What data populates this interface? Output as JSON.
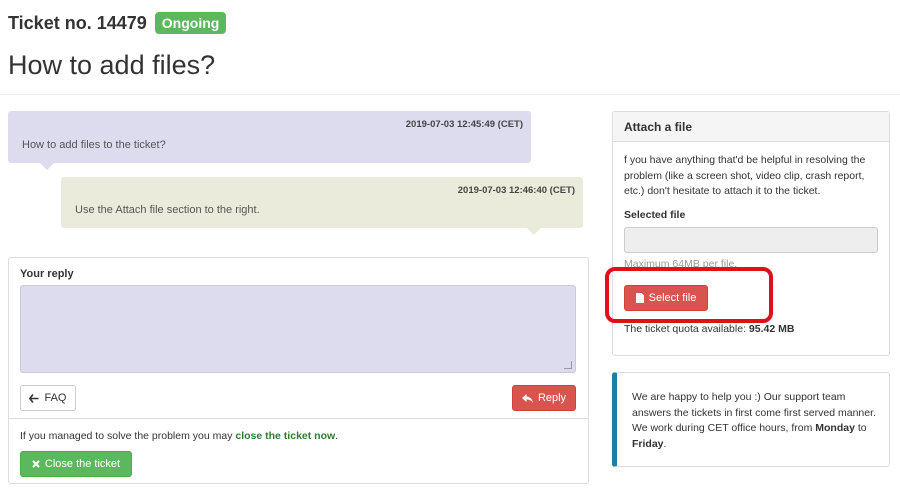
{
  "ticket": {
    "label": "Ticket no.",
    "number": "14479",
    "status": "Ongoing",
    "title": "How to add files?"
  },
  "messages": [
    {
      "time": "2019-07-03 12:45:49 (CET)",
      "text": "How to add files to the ticket?"
    },
    {
      "time": "2019-07-03 12:46:40 (CET)",
      "text": "Use the Attach file section to the right."
    }
  ],
  "reply": {
    "label": "Your reply",
    "faq_label": "FAQ",
    "reply_label": "Reply",
    "close_note_prefix": "If you managed to solve the problem you may ",
    "close_note_link": "close the ticket now",
    "close_note_suffix": ".",
    "close_label": "Close the ticket"
  },
  "attach": {
    "heading": "Attach a file",
    "description": "f you have anything that'd be helpful in resolving the problem (like a screen shot, video clip, crash report, etc.) don't hesitate to attach it to the ticket.",
    "selected_label": "Selected file",
    "max_note": "Maximum 64MB per file.",
    "select_label": "Select file",
    "quota_prefix": "The ticket quota available: ",
    "quota_value": "95.42 MB"
  },
  "info": {
    "text_main": "We are happy to help you :) Our support team answers the tickets in first come first served manner. We work during CET office hours, from ",
    "day_from": "Monday",
    "text_to": " to ",
    "day_to": "Friday",
    "text_end": "."
  },
  "colors": {
    "success": "#5cb85c",
    "danger": "#d9534f",
    "question_bubble": "#dcdcee",
    "answer_bubble": "#ebebdc",
    "info_accent": "#1b809e",
    "highlight": "#e0101a"
  },
  "icons": {
    "faq": "arrow-left-icon",
    "reply": "reply-icon",
    "close": "close-icon",
    "select": "file-icon"
  }
}
